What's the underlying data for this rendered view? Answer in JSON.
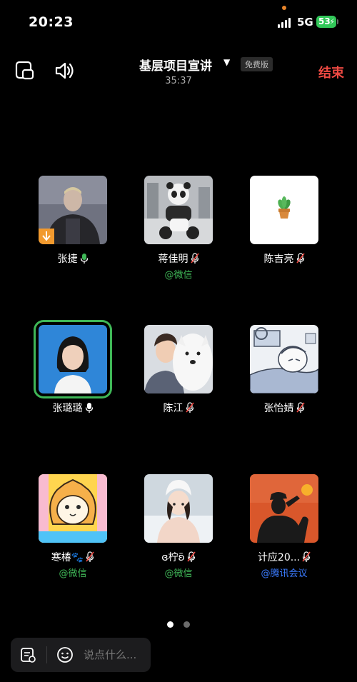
{
  "status_bar": {
    "time": "20:23",
    "network": "5G",
    "battery": "53"
  },
  "header": {
    "title": "基层项目宣讲",
    "badge": "免费版",
    "timer": "35:37",
    "end_label": "结束"
  },
  "participants": [
    {
      "name": "张捷",
      "mic": "on",
      "source": ""
    },
    {
      "name": "蒋佳明",
      "mic": "muted",
      "source": "@微信",
      "source_type": "wechat"
    },
    {
      "name": "陈吉亮",
      "mic": "muted",
      "source": ""
    },
    {
      "name": "张璐璐",
      "mic": "on-white",
      "source": "",
      "active": true
    },
    {
      "name": "陈江",
      "mic": "muted",
      "source": ""
    },
    {
      "name": "张怡婧",
      "mic": "muted",
      "source": ""
    },
    {
      "name": "寒椿🐾",
      "mic": "muted",
      "source": "@微信",
      "source_type": "wechat"
    },
    {
      "name": "ɞ柠ʚ̈",
      "mic": "muted",
      "source": "@微信",
      "source_type": "wechat"
    },
    {
      "name": "计应20...",
      "mic": "muted",
      "source": "@腾讯会议",
      "source_type": "tencent"
    }
  ],
  "pagination": {
    "current": 1,
    "total": 2
  },
  "chat": {
    "placeholder": "说点什么..."
  },
  "colors": {
    "accent_green": "#3fb757",
    "end_red": "#f04a43",
    "tencent_blue": "#3a7bff"
  }
}
